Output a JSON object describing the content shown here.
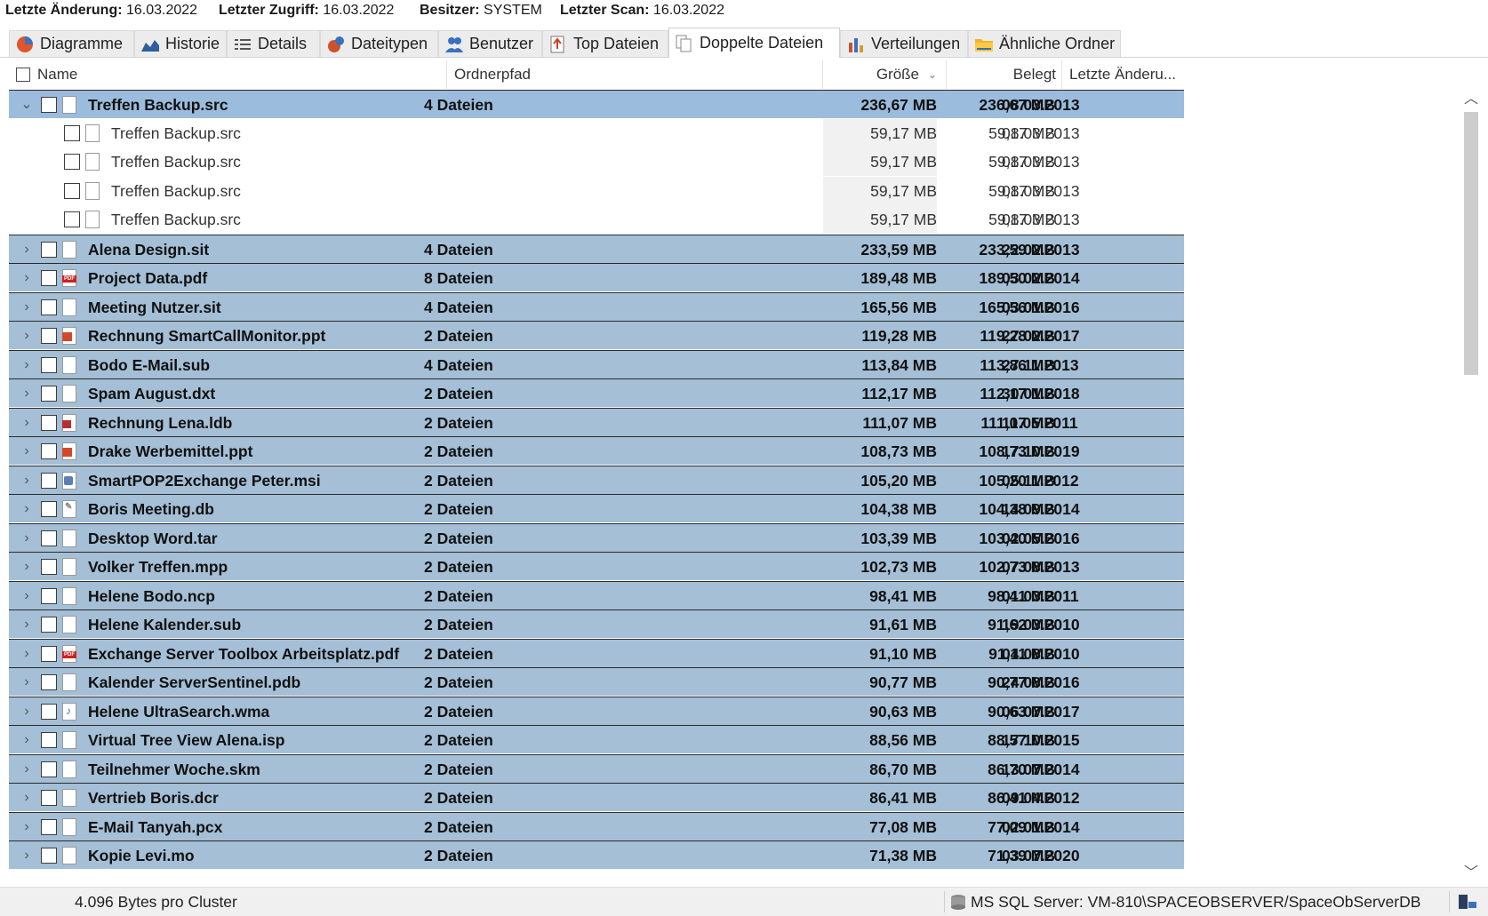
{
  "info": [
    {
      "label": "Letzte Änderung:",
      "value": "16.03.2022"
    },
    {
      "label": "Letzter Zugriff:",
      "value": "16.03.2022"
    },
    {
      "label": "Besitzer:",
      "value": "SYSTEM"
    },
    {
      "label": "Letzter Scan:",
      "value": "16.03.2022"
    }
  ],
  "tabs": [
    {
      "label": "Diagramme",
      "icon": "pie-chart-icon"
    },
    {
      "label": "Historie",
      "icon": "history-icon"
    },
    {
      "label": "Details",
      "icon": "details-list-icon"
    },
    {
      "label": "Dateitypen",
      "icon": "file-types-icon"
    },
    {
      "label": "Benutzer",
      "icon": "users-icon"
    },
    {
      "label": "Top Dateien",
      "icon": "top-files-icon"
    },
    {
      "label": "Doppelte Dateien",
      "icon": "duplicate-files-icon",
      "active": true
    },
    {
      "label": "Verteilungen",
      "icon": "bar-chart-icon"
    },
    {
      "label": "Ähnliche Ordner",
      "icon": "folder-icon"
    }
  ],
  "columns": {
    "name": "Name",
    "path": "Ordnerpfad",
    "size": "Größe",
    "allocated": "Belegt",
    "modified": "Letzte Änderu..."
  },
  "rows": [
    {
      "kind": "group",
      "expanded": true,
      "selected": true,
      "name": "Treffen Backup.src",
      "icon": "file",
      "path": "4 Dateien",
      "size": "236,67 MB",
      "allocated": "236,67 MB",
      "modified": "08.03.2013"
    },
    {
      "kind": "child",
      "name": "Treffen Backup.src",
      "icon": "file",
      "path": "",
      "size": "59,17 MB",
      "allocated": "59,17 MB",
      "modified": "08.03.2013"
    },
    {
      "kind": "child",
      "name": "Treffen Backup.src",
      "icon": "file",
      "path": "",
      "size": "59,17 MB",
      "allocated": "59,17 MB",
      "modified": "08.03.2013"
    },
    {
      "kind": "child",
      "name": "Treffen Backup.src",
      "icon": "file",
      "path": "",
      "size": "59,17 MB",
      "allocated": "59,17 MB",
      "modified": "08.03.2013"
    },
    {
      "kind": "child",
      "name": "Treffen Backup.src",
      "icon": "file",
      "path": "",
      "size": "59,17 MB",
      "allocated": "59,17 MB",
      "modified": "08.03.2013"
    },
    {
      "kind": "group",
      "name": "Alena Design.sit",
      "icon": "file",
      "path": "4 Dateien",
      "size": "233,59 MB",
      "allocated": "233,59 MB",
      "modified": "22.02.2013"
    },
    {
      "kind": "group",
      "name": "Project Data.pdf",
      "icon": "pdf",
      "path": "8 Dateien",
      "size": "189,48 MB",
      "allocated": "189,50 MB",
      "modified": "03.02.2014"
    },
    {
      "kind": "group",
      "name": "Meeting Nutzer.sit",
      "icon": "file",
      "path": "4 Dateien",
      "size": "165,56 MB",
      "allocated": "165,56 MB",
      "modified": "03.01.2016"
    },
    {
      "kind": "group",
      "name": "Rechnung SmartCallMonitor.ppt",
      "icon": "ppt",
      "path": "2 Dateien",
      "size": "119,28 MB",
      "allocated": "119,28 MB",
      "modified": "27.02.2017"
    },
    {
      "kind": "group",
      "name": "Bodo E-Mail.sub",
      "icon": "file",
      "path": "4 Dateien",
      "size": "113,84 MB",
      "allocated": "113,86 MB",
      "modified": "27.11.2013"
    },
    {
      "kind": "group",
      "name": "Spam August.dxt",
      "icon": "file",
      "path": "2 Dateien",
      "size": "112,17 MB",
      "allocated": "112,17 MB",
      "modified": "30.01.2018"
    },
    {
      "kind": "group",
      "name": "Rechnung Lena.ldb",
      "icon": "ldb",
      "path": "2 Dateien",
      "size": "111,07 MB",
      "allocated": "111,07 MB",
      "modified": "11.05.2011"
    },
    {
      "kind": "group",
      "name": "Drake Werbemittel.ppt",
      "icon": "ppt",
      "path": "2 Dateien",
      "size": "108,73 MB",
      "allocated": "108,73 MB",
      "modified": "17.10.2019"
    },
    {
      "kind": "group",
      "name": "SmartPOP2Exchange Peter.msi",
      "icon": "msi",
      "path": "2 Dateien",
      "size": "105,20 MB",
      "allocated": "105,20 MB",
      "modified": "05.11.2012"
    },
    {
      "kind": "group",
      "name": "Boris Meeting.db",
      "icon": "db",
      "path": "2 Dateien",
      "size": "104,38 MB",
      "allocated": "104,38 MB",
      "modified": "14.09.2014"
    },
    {
      "kind": "group",
      "name": "Desktop Word.tar",
      "icon": "file",
      "path": "2 Dateien",
      "size": "103,39 MB",
      "allocated": "103,40 MB",
      "modified": "02.05.2016"
    },
    {
      "kind": "group",
      "name": "Volker Treffen.mpp",
      "icon": "file",
      "path": "2 Dateien",
      "size": "102,73 MB",
      "allocated": "102,73 MB",
      "modified": "07.08.2013"
    },
    {
      "kind": "group",
      "name": "Helene Bodo.ncp",
      "icon": "file",
      "path": "2 Dateien",
      "size": "98,41 MB",
      "allocated": "98,41 MB",
      "modified": "01.03.2011"
    },
    {
      "kind": "group",
      "name": "Helene Kalender.sub",
      "icon": "file",
      "path": "2 Dateien",
      "size": "91,61 MB",
      "allocated": "91,62 MB",
      "modified": "19.03.2010"
    },
    {
      "kind": "group",
      "name": "Exchange Server Toolbox Arbeitsplatz.pdf",
      "icon": "pdf",
      "path": "2 Dateien",
      "size": "91,10 MB",
      "allocated": "91,11 MB",
      "modified": "04.08.2010"
    },
    {
      "kind": "group",
      "name": "Kalender ServerSentinel.pdb",
      "icon": "file",
      "path": "2 Dateien",
      "size": "90,77 MB",
      "allocated": "90,77 MB",
      "modified": "24.08.2016"
    },
    {
      "kind": "group",
      "name": "Helene UltraSearch.wma",
      "icon": "wma",
      "path": "2 Dateien",
      "size": "90,63 MB",
      "allocated": "90,63 MB",
      "modified": "06.07.2017"
    },
    {
      "kind": "group",
      "name": "Virtual Tree View Alena.isp",
      "icon": "file",
      "path": "2 Dateien",
      "size": "88,56 MB",
      "allocated": "88,57 MB",
      "modified": "17.10.2015"
    },
    {
      "kind": "group",
      "name": "Teilnehmer Woche.skm",
      "icon": "file",
      "path": "2 Dateien",
      "size": "86,70 MB",
      "allocated": "86,70 MB",
      "modified": "13.07.2014"
    },
    {
      "kind": "group",
      "name": "Vertrieb Boris.dcr",
      "icon": "file",
      "path": "2 Dateien",
      "size": "86,41 MB",
      "allocated": "86,41 MB",
      "modified": "09.04.2012"
    },
    {
      "kind": "group",
      "name": "E-Mail Tanyah.pcx",
      "icon": "file",
      "path": "2 Dateien",
      "size": "77,08 MB",
      "allocated": "77,09 MB",
      "modified": "02.01.2014"
    },
    {
      "kind": "group",
      "name": "Kopie Levi.mo",
      "icon": "file",
      "path": "2 Dateien",
      "size": "71,38 MB",
      "allocated": "71,39 MB",
      "modified": "03.07.2020"
    }
  ],
  "status": {
    "cluster": "4.096 Bytes pro Cluster",
    "server": "MS SQL Server: VM-810\\SPACEOBSERVER/SpaceObServerDB"
  },
  "colors": {
    "group_row": "#a4bfd6",
    "selected_row": "#9bbcdc",
    "row_border": "#2b2b2b"
  }
}
